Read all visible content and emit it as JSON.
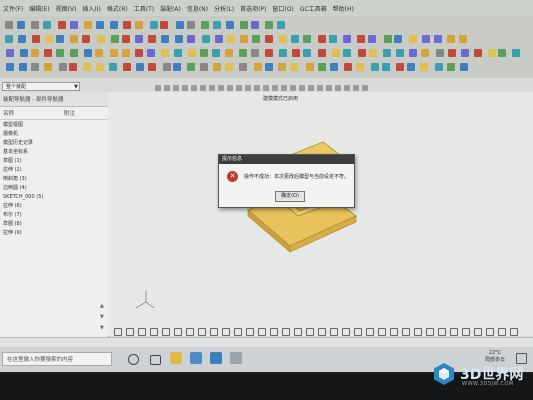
{
  "menu": {
    "items": [
      "文件(F)",
      "编辑(E)",
      "视图(V)",
      "插入(I)",
      "格式(R)",
      "工具(T)",
      "装配(A)",
      "信息(N)",
      "分析(L)",
      "首选项(P)",
      "窗口(O)",
      "GC工具箱",
      "帮助(H)"
    ]
  },
  "toolbar": {
    "filter_combo": "整个装配"
  },
  "left_panel": {
    "title": "装配导航器 - 部件导航器",
    "header_name": "名称",
    "header_col": "附注",
    "items": [
      "模型视图",
      "摄像机",
      "模型历史记录",
      "基本坐标系",
      "草图 (1)",
      "拉伸 (2)",
      "倒斜角 (3)",
      "边倒圆 (4)",
      "SKETCH_000 (5)",
      "拉伸 (6)",
      "布尔 (7)",
      "草图 (8)",
      "拉伸 (9)"
    ]
  },
  "viewport": {
    "title": "建模模式已启用"
  },
  "dialog": {
    "title": "提示信息",
    "message": "操作不成功：本次更改后模型与当前设定不符。",
    "ok_label": "确定(O)"
  },
  "statusbar": {
    "text": ""
  },
  "taskbar": {
    "search_placeholder": "在这里输入你要搜索的内容",
    "clock_line1": "22°C",
    "clock_line2": "局部多云"
  },
  "watermark": {
    "brand": "3D世界网",
    "url": "WWW.3DSJW.COM"
  },
  "colors": {
    "part_yellow": "#e6c050",
    "part_edge": "#b8922a",
    "dialog_error": "#c23b2a"
  }
}
